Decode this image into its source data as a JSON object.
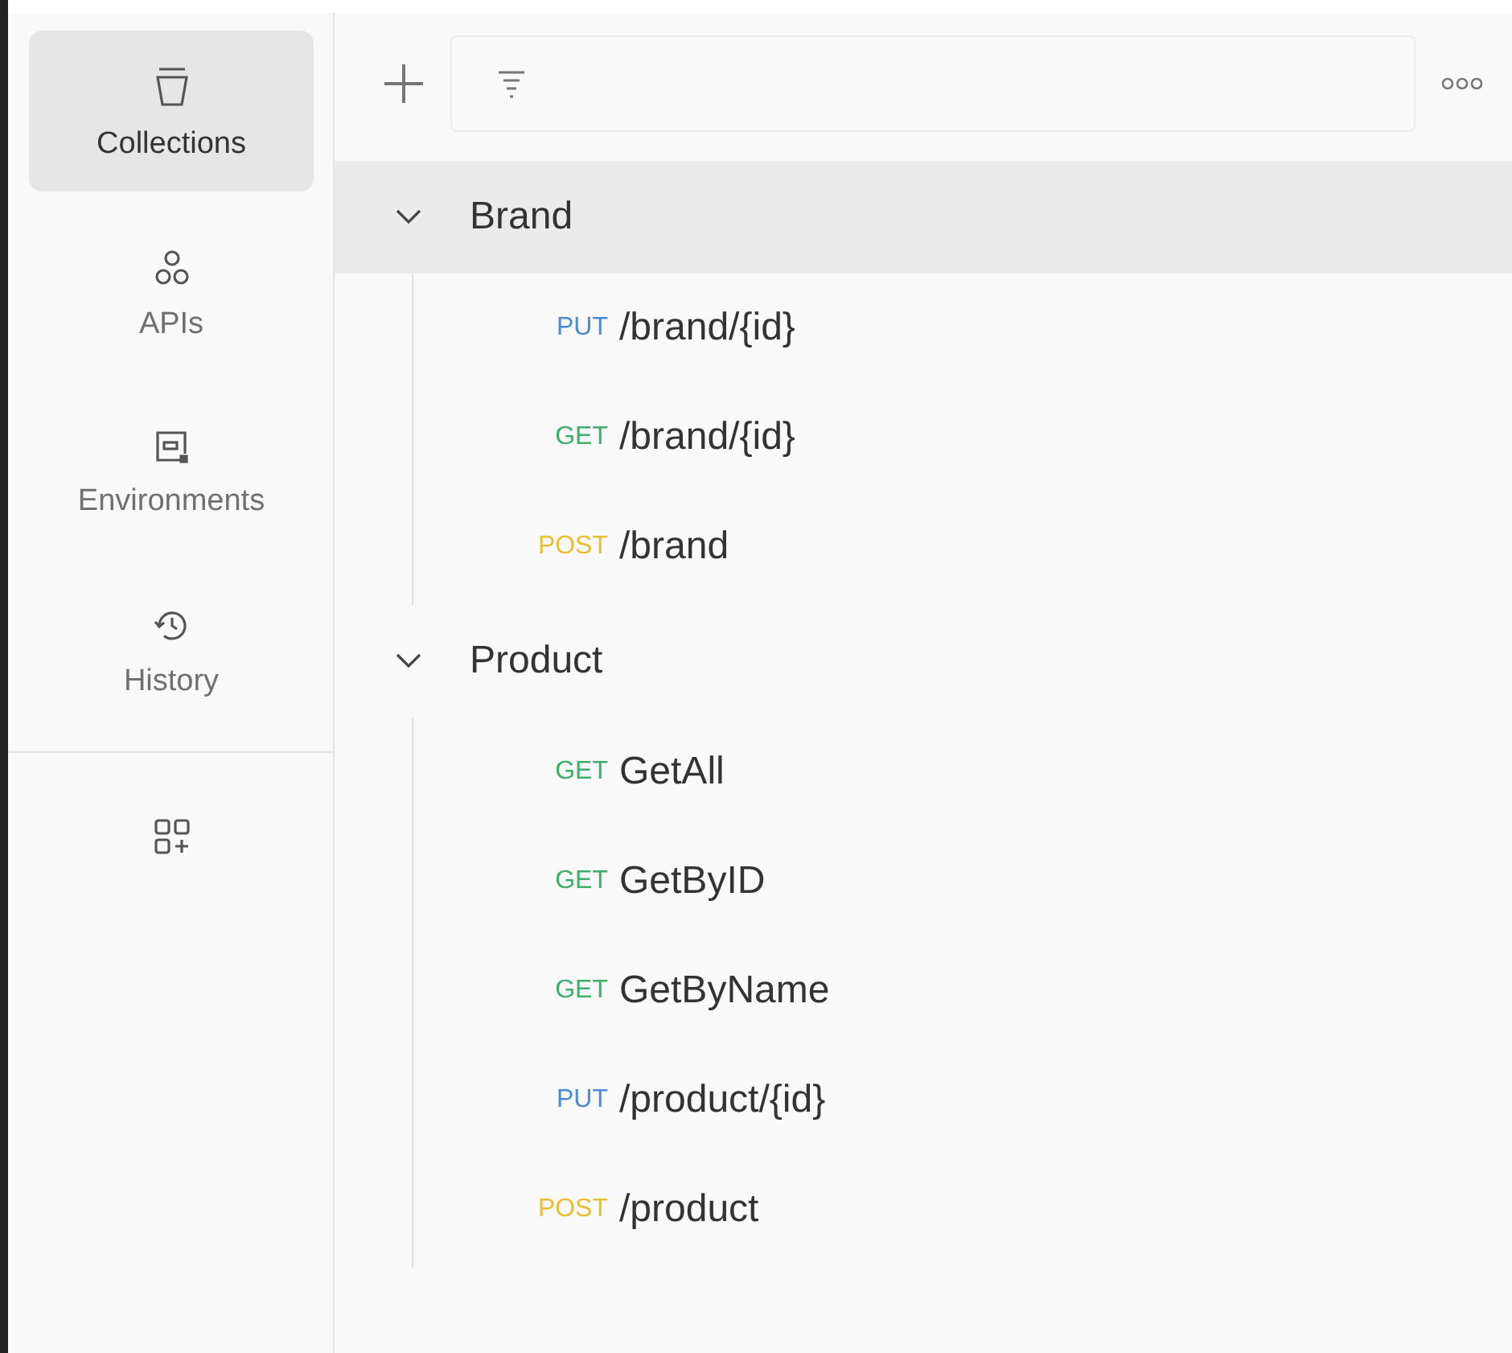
{
  "sidebar": {
    "items": [
      {
        "kind": "collections",
        "label": "Collections",
        "selected": true
      },
      {
        "kind": "apis",
        "label": "APIs",
        "selected": false
      },
      {
        "kind": "environments",
        "label": "Environments",
        "selected": false
      },
      {
        "kind": "history",
        "label": "History",
        "selected": false
      }
    ]
  },
  "collections": [
    {
      "name": "Brand",
      "expanded": true,
      "selected": true,
      "children": [
        {
          "method": "PUT",
          "color": "#4a8ad6",
          "name": "/brand/{id}"
        },
        {
          "method": "GET",
          "color": "#3fae6a",
          "name": "/brand/{id}"
        },
        {
          "method": "POST",
          "color": "#e8be33",
          "name": "/brand"
        }
      ]
    },
    {
      "name": "Product",
      "expanded": true,
      "selected": false,
      "children": [
        {
          "method": "GET",
          "color": "#3fae6a",
          "name": "GetAll"
        },
        {
          "method": "GET",
          "color": "#3fae6a",
          "name": "GetByID"
        },
        {
          "method": "GET",
          "color": "#3fae6a",
          "name": "GetByName"
        },
        {
          "method": "PUT",
          "color": "#4a8ad6",
          "name": "/product/{id}"
        },
        {
          "method": "POST",
          "color": "#e8be33",
          "name": "/product"
        }
      ]
    }
  ]
}
